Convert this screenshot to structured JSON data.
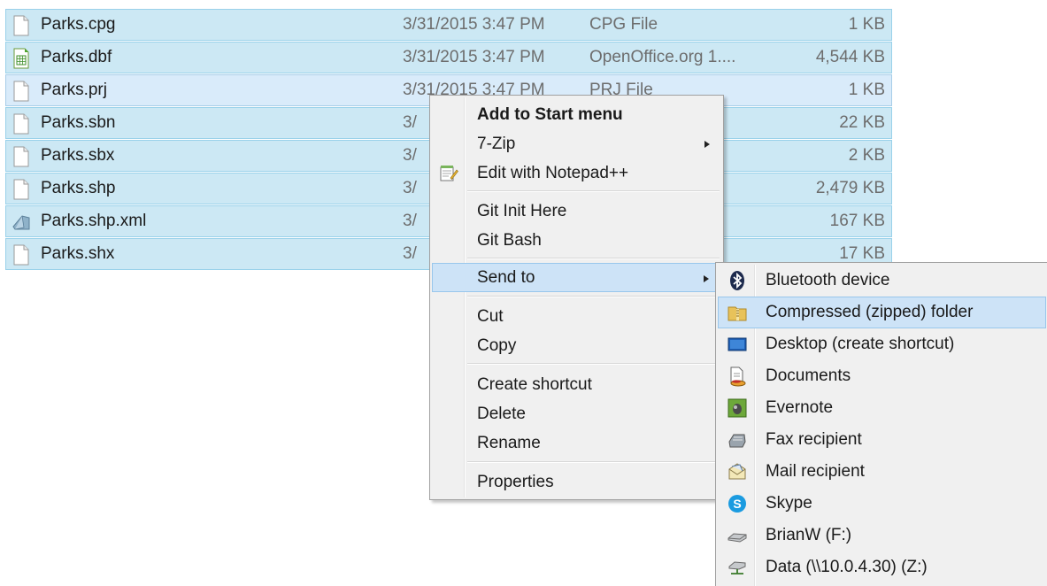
{
  "files": [
    {
      "name": "Parks.cpg",
      "date": "3/31/2015 3:47 PM",
      "type": "CPG File",
      "size": "1 KB",
      "icon": "blank-file-icon"
    },
    {
      "name": "Parks.dbf",
      "date": "3/31/2015 3:47 PM",
      "type": "OpenOffice.org 1....",
      "size": "4,544 KB",
      "icon": "spreadsheet-file-icon"
    },
    {
      "name": "Parks.prj",
      "date": "3/31/2015 3:47 PM",
      "type": "PRJ File",
      "size": "1 KB",
      "icon": "blank-file-icon"
    },
    {
      "name": "Parks.sbn",
      "date": "3/",
      "type": "",
      "size": "22 KB",
      "icon": "blank-file-icon"
    },
    {
      "name": "Parks.sbx",
      "date": "3/",
      "type": "",
      "size": "2 KB",
      "icon": "blank-file-icon"
    },
    {
      "name": "Parks.shp",
      "date": "3/",
      "type": "",
      "size": "2,479 KB",
      "icon": "blank-file-icon"
    },
    {
      "name": "Parks.shp.xml",
      "date": "3/",
      "type": "",
      "size": "167 KB",
      "icon": "xml-file-icon"
    },
    {
      "name": "Parks.shx",
      "date": "3/",
      "type": "",
      "size": "17 KB",
      "icon": "blank-file-icon"
    }
  ],
  "context_menu": {
    "add_to_start": "Add to Start menu",
    "seven_zip": "7-Zip",
    "edit_notepad": "Edit with Notepad++",
    "git_init": "Git Init Here",
    "git_bash": "Git Bash",
    "send_to": "Send to",
    "cut": "Cut",
    "copy": "Copy",
    "create_shortcut": "Create shortcut",
    "delete": "Delete",
    "rename": "Rename",
    "properties": "Properties"
  },
  "send_to_menu": [
    {
      "label": "Bluetooth device",
      "icon": "bluetooth-icon"
    },
    {
      "label": "Compressed (zipped) folder",
      "icon": "zip-folder-icon"
    },
    {
      "label": "Desktop (create shortcut)",
      "icon": "desktop-icon"
    },
    {
      "label": "Documents",
      "icon": "documents-icon"
    },
    {
      "label": "Evernote",
      "icon": "evernote-icon"
    },
    {
      "label": "Fax recipient",
      "icon": "fax-icon"
    },
    {
      "label": "Mail recipient",
      "icon": "mail-icon"
    },
    {
      "label": "Skype",
      "icon": "skype-icon"
    },
    {
      "label": "BrianW (F:)",
      "icon": "removable-drive-icon"
    },
    {
      "label": "Data (\\\\10.0.4.30) (Z:)",
      "icon": "network-drive-icon"
    }
  ],
  "colors": {
    "selection_fill": "#cce8f4",
    "selection_border": "#99d1ea",
    "menu_background": "#f0f0f0",
    "menu_highlight": "#cde3f7"
  }
}
